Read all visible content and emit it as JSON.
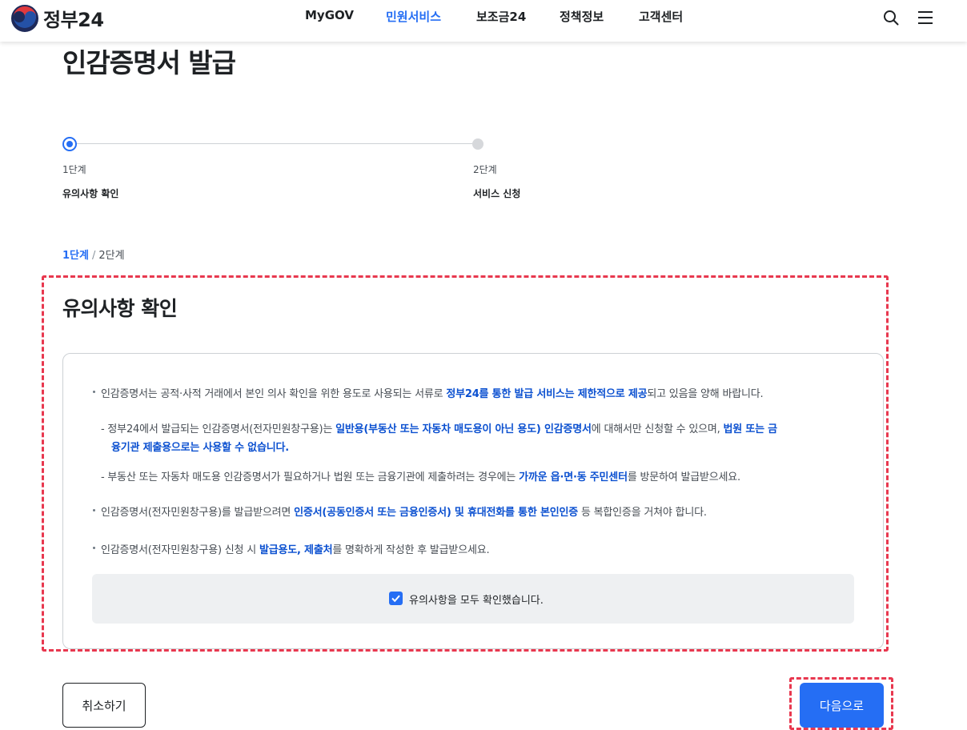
{
  "header": {
    "logo_text": "정부24",
    "nav": [
      "MyGOV",
      "민원서비스",
      "보조금24",
      "정책정보",
      "고객센터"
    ],
    "active_nav": "민원서비스",
    "icons": [
      "search-icon",
      "menu-icon"
    ]
  },
  "page": {
    "title": "인감증명서 발급"
  },
  "stepper": {
    "steps": [
      {
        "num": "1단계",
        "label": "유의사항 확인",
        "state": "current"
      },
      {
        "num": "2단계",
        "label": "서비스 신청",
        "state": "upcoming"
      }
    ]
  },
  "breadcrumb": {
    "current": "1단계",
    "separator": "/",
    "next": "2단계"
  },
  "notice": {
    "title": "유의사항 확인",
    "l1_a": "인감증명서는 공적·사적 거래에서 본인 의사 확인을 위한 용도로 사용되는 서류로 ",
    "l1_b": "정부24를 통한 발급 서비스는 제한적으로 제공",
    "l1_c": "되고 있음을 양해 바랍니다.",
    "l2_a": "- 정부24에서 발급되는 인감증명서(전자민원창구용)는 ",
    "l2_b": "일반용(부동산 또는 자동차 매도용이 아닌 용도) 인감증명서",
    "l2_c": "에 대해서만 신청할 수 있으며, ",
    "l2_d": "법원 또는 금",
    "l2_e": "융기관 제출용으로는 사용할 수 없습니다.",
    "l3_a": "- 부동산 또는 자동차 매도용 인감증명서가 필요하거나 법원 또는 금융기관에 제출하려는 경우에는 ",
    "l3_b": "가까운 읍·면·동 주민센터",
    "l3_c": "를 방문하여 발급받으세요.",
    "l4_a": "인감증명서(전자민원창구용)를 발급받으려면 ",
    "l4_b": "인증서(공동인증서 또는 금융인증서) 및 휴대전화를 통한 본인인증",
    "l4_c": " 등 복합인증을 거쳐야 합니다.",
    "l5_a": "인감증명서(전자민원창구용) 신청 시 ",
    "l5_b": "발급용도, 제출처",
    "l5_c": "를 명확하게 작성한 후 발급받으세요.",
    "checkbox_label": "유의사항을 모두 확인했습니다.",
    "checked": true
  },
  "buttons": {
    "cancel": "취소하기",
    "next": "다음으로"
  },
  "colors": {
    "accent": "#256ef4",
    "emphasis": "#0b50d0",
    "highlight": "#e8384f"
  }
}
